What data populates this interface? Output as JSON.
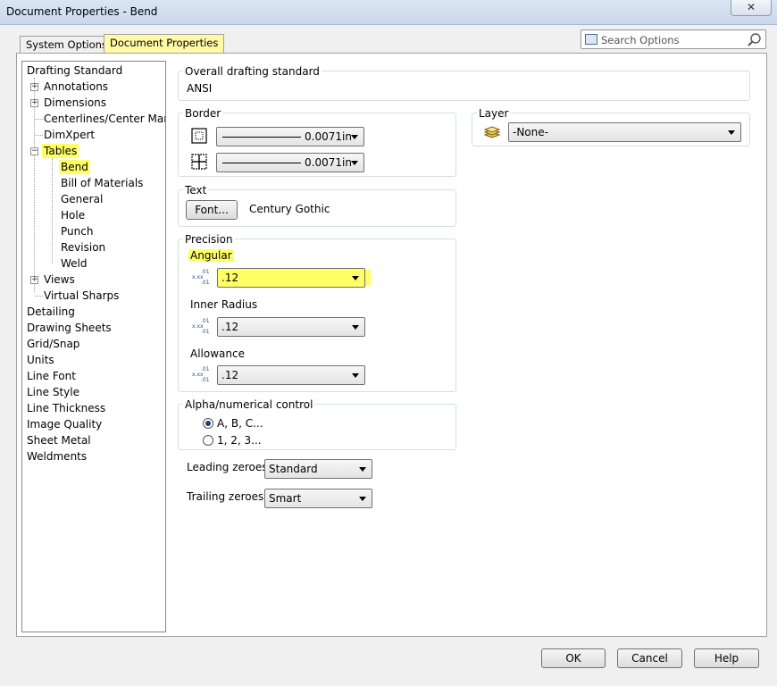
{
  "window": {
    "title": "Document Properties - Bend",
    "close_label": "✕"
  },
  "tabs": [
    {
      "label": "System Options"
    },
    {
      "label": "Document Properties"
    }
  ],
  "search": {
    "placeholder": "Search Options"
  },
  "tree": [
    "Drafting Standard",
    "Annotations",
    "Dimensions",
    "Centerlines/Center Marks",
    "DimXpert",
    "Tables",
    "Bend",
    "Bill of Materials",
    "General",
    "Hole",
    "Punch",
    "Revision",
    "Weld",
    "Views",
    "Virtual Sharps",
    "Detailing",
    "Drawing Sheets",
    "Grid/Snap",
    "Units",
    "Line Font",
    "Line Style",
    "Line Thickness",
    "Image Quality",
    "Sheet Metal",
    "Weldments"
  ],
  "overall": {
    "label": "Overall drafting standard",
    "value": "ANSI"
  },
  "border": {
    "label": "Border",
    "thickness1": "0.0071in",
    "thickness2": "0.0071in"
  },
  "text": {
    "label": "Text",
    "font_button": "Font...",
    "font_name": "Century Gothic"
  },
  "precision": {
    "label": "Precision",
    "angular_label": "Angular",
    "angular_value": ".12",
    "inner_radius_label": "Inner Radius",
    "inner_radius_value": ".12",
    "allowance_label": "Allowance",
    "allowance_value": ".12",
    "icon_top": ".01",
    "icon_mid": "x.xx",
    "icon_bot": ".01"
  },
  "alpha": {
    "label": "Alpha/numerical control",
    "option1": "A, B, C...",
    "option2": "1, 2, 3...",
    "selected": "A, B, C..."
  },
  "leading": {
    "label": "Leading zeroes:",
    "value": "Standard"
  },
  "trailing": {
    "label": "Trailing zeroes:",
    "value": "Smart"
  },
  "layer": {
    "label": "Layer",
    "value": "-None-"
  },
  "buttons": {
    "ok": "OK",
    "cancel": "Cancel",
    "help": "Help"
  },
  "colors": {
    "highlight": "#ffff66",
    "panel_border": "#a0a0a0"
  }
}
